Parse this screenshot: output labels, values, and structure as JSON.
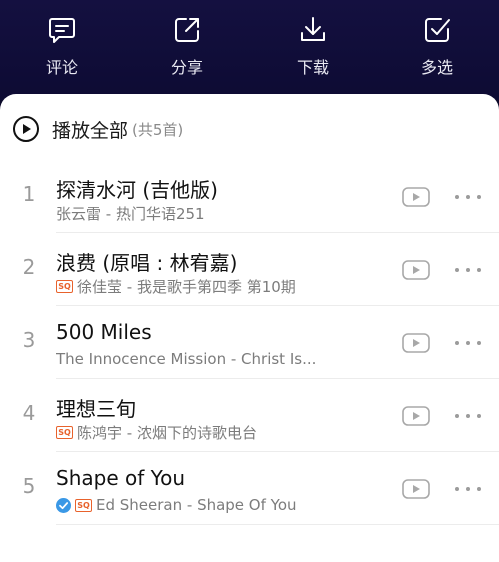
{
  "actions": [
    {
      "label": "评论",
      "icon": "comment-icon"
    },
    {
      "label": "分享",
      "icon": "share-icon"
    },
    {
      "label": "下载",
      "icon": "download-icon"
    },
    {
      "label": "多选",
      "icon": "multi-select-icon"
    }
  ],
  "play_all": {
    "label": "播放全部",
    "count": "(共5首)",
    "icon": "play-circle-icon"
  },
  "songs": [
    {
      "index": "1",
      "title": "探清水河 (吉他版)",
      "subtitle": "张云雷 - 热门华语251",
      "sq": false,
      "verified": false
    },
    {
      "index": "2",
      "title": "浪费 (原唱 : 林宥嘉)",
      "subtitle": "徐佳莹 - 我是歌手第四季 第10期",
      "sq": true,
      "verified": false
    },
    {
      "index": "3",
      "title": "500 Miles",
      "subtitle": "The Innocence Mission - Christ Is...",
      "sq": false,
      "verified": false
    },
    {
      "index": "4",
      "title": "理想三旬",
      "subtitle": "陈鸿宇 - 浓烟下的诗歌电台",
      "sq": true,
      "verified": false
    },
    {
      "index": "5",
      "title": "Shape of You",
      "subtitle": "Ed Sheeran - Shape Of You",
      "sq": true,
      "verified": true
    }
  ],
  "badge_text": "SQ",
  "colors": {
    "top_bar": "#141040",
    "sheet": "#ffffff",
    "sq_badge": "#e8622c",
    "verified": "#3a98e6"
  }
}
